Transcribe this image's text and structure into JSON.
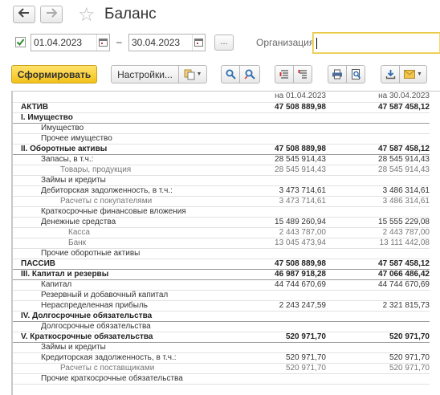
{
  "window": {
    "title": "Баланс",
    "back_icon": "arrow-left-icon",
    "forward_icon": "arrow-right-icon",
    "favorite_icon": "star-icon"
  },
  "period": {
    "enabled_checkbox": "checked",
    "date_from": "01.04.2023",
    "separator": "–",
    "date_to": "30.04.2023",
    "choose_period_label": "...",
    "organization_label": "Организация:",
    "organization_value": ""
  },
  "toolbar": {
    "generate_label": "Сформировать",
    "settings_label": "Настройки...",
    "accent_color": "#f5c518"
  },
  "report": {
    "col_date1": "на 01.04.2023",
    "col_date2": "на 30.04.2023",
    "rows": [
      {
        "name": "АКТИВ",
        "v1": "47 508 889,98",
        "v2": "47 587 458,12"
      },
      {
        "name": "I. Имущество",
        "v1": "",
        "v2": ""
      },
      {
        "name": "Имущество",
        "v1": "",
        "v2": ""
      },
      {
        "name": "Прочее имущество",
        "v1": "",
        "v2": ""
      },
      {
        "name": "II. Оборотные активы",
        "v1": "47 508 889,98",
        "v2": "47 587 458,12"
      },
      {
        "name": "Запасы, в т.ч.:",
        "v1": "28 545 914,43",
        "v2": "28 545 914,43"
      },
      {
        "name": "Товары, продукция",
        "v1": "28 545 914,43",
        "v2": "28 545 914,43"
      },
      {
        "name": "Займы и кредиты",
        "v1": "",
        "v2": ""
      },
      {
        "name": "Дебиторская задолженность, в т.ч.:",
        "v1": "3 473 714,61",
        "v2": "3 486 314,61"
      },
      {
        "name": "Расчеты с покупателями",
        "v1": "3 473 714,61",
        "v2": "3 486 314,61"
      },
      {
        "name": "Краткосрочные финансовые вложения",
        "v1": "",
        "v2": ""
      },
      {
        "name": "Денежные средства",
        "v1": "15 489 260,94",
        "v2": "15 555 229,08"
      },
      {
        "name": "Касса",
        "v1": "2 443 787,00",
        "v2": "2 443 787,00"
      },
      {
        "name": "Банк",
        "v1": "13 045 473,94",
        "v2": "13 111 442,08"
      },
      {
        "name": "Прочие оборотные активы",
        "v1": "",
        "v2": ""
      },
      {
        "name": "ПАССИВ",
        "v1": "47 508 889,98",
        "v2": "47 587 458,12"
      },
      {
        "name": "III. Капитал и резервы",
        "v1": "46 987 918,28",
        "v2": "47 066 486,42"
      },
      {
        "name": "Капитал",
        "v1": "44 744 670,69",
        "v2": "44 744 670,69"
      },
      {
        "name": "Резервный и добавочный капитал",
        "v1": "",
        "v2": ""
      },
      {
        "name": "Нераспределенная прибыль",
        "v1": "2 243 247,59",
        "v2": "2 321 815,73"
      },
      {
        "name": "IV. Долгосрочные обязательства",
        "v1": "",
        "v2": ""
      },
      {
        "name": "Долгосрочные обязательства",
        "v1": "",
        "v2": ""
      },
      {
        "name": "V. Краткосрочные обязательства",
        "v1": "520 971,70",
        "v2": "520 971,70"
      },
      {
        "name": "Займы и кредиты",
        "v1": "",
        "v2": ""
      },
      {
        "name": "Кредиторская задолженность, в т.ч.:",
        "v1": "520 971,70",
        "v2": "520 971,70"
      },
      {
        "name": "Расчеты с поставщиками",
        "v1": "520 971,70",
        "v2": "520 971,70"
      },
      {
        "name": "Прочие краткосрочные обязательства",
        "v1": "",
        "v2": ""
      }
    ]
  }
}
